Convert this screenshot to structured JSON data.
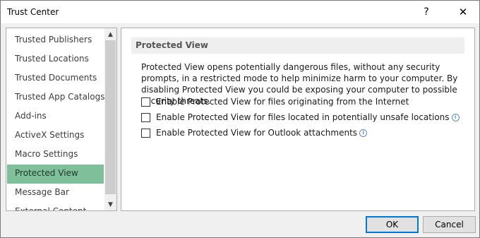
{
  "window": {
    "title": "Trust Center",
    "help_glyph": "?",
    "close_glyph": "✕"
  },
  "nav": {
    "items": [
      {
        "label": "Trusted Publishers"
      },
      {
        "label": "Trusted Locations"
      },
      {
        "label": "Trusted Documents"
      },
      {
        "label": "Trusted App Catalogs"
      },
      {
        "label": "Add-ins"
      },
      {
        "label": "ActiveX Settings"
      },
      {
        "label": "Macro Settings"
      },
      {
        "label": "Protected View"
      },
      {
        "label": "Message Bar"
      },
      {
        "label": "External Content"
      }
    ],
    "selected_index": 7,
    "selected_color": "#7fbf9a"
  },
  "section": {
    "title": "Protected View",
    "description": "Protected View opens potentially dangerous files, without any security prompts, in a restricted mode to help minimize harm to your computer. By disabling Protected View you could be exposing your computer to possible security threats.",
    "options": [
      {
        "label": "Enable Protected View for files originating from the Internet",
        "checked": false,
        "info_icon": false
      },
      {
        "label": "Enable Protected View for files located in potentially unsafe locations",
        "checked": false,
        "info_icon": true
      },
      {
        "label": "Enable Protected View for Outlook attachments",
        "checked": false,
        "info_icon": true
      }
    ]
  },
  "footer": {
    "ok_label": "OK",
    "cancel_label": "Cancel"
  },
  "icons": {
    "help": "question-mark-icon",
    "close": "close-icon",
    "scroll_up": "chevron-up-icon",
    "scroll_down": "chevron-down-icon",
    "info": "info-icon"
  }
}
